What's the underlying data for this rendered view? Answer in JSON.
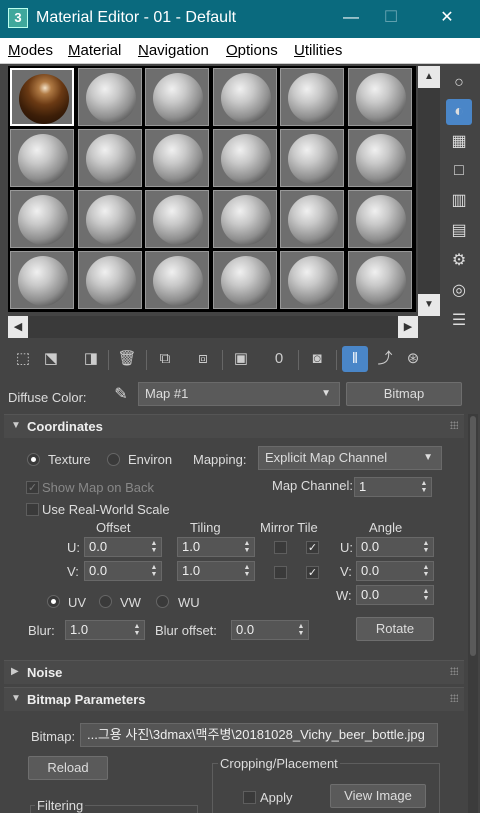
{
  "window": {
    "app_icon": "3",
    "title": "Material Editor - 01 - Default",
    "minimize": "—",
    "maximize": "☐",
    "close": "✕"
  },
  "menu": [
    {
      "label_u": "M",
      "label_rest": "odes"
    },
    {
      "label_u": "M",
      "label_rest": "aterial"
    },
    {
      "label_u": "N",
      "label_rest": "avigation"
    },
    {
      "label_u": "O",
      "label_rest": "ptions"
    },
    {
      "label_u": "U",
      "label_rest": "tilities"
    }
  ],
  "slots": {
    "rows": 4,
    "cols": 6,
    "active_slot": 0,
    "active_material": "beer-bottle-brown"
  },
  "map": {
    "diffuse_label": "Diffuse Color:",
    "map_name": "Map #1",
    "map_type_button": "Bitmap",
    "toolbar_value": "0"
  },
  "coordinates": {
    "title": "Coordinates",
    "texture_label": "Texture",
    "environ_label": "Environ",
    "mapping_label": "Mapping:",
    "mapping_value": "Explicit Map Channel",
    "show_map_on_back": "Show Map on Back",
    "map_channel_label": "Map Channel:",
    "map_channel_value": "1",
    "real_world": "Use Real-World Scale",
    "offset_header": "Offset",
    "tiling_header": "Tiling",
    "mirror_tile_header": "Mirror Tile",
    "angle_header": "Angle",
    "u_label": "U:",
    "v_label": "V:",
    "w_label": "W:",
    "offset_u": "0.0",
    "offset_v": "0.0",
    "tiling_u": "1.0",
    "tiling_v": "1.0",
    "tile_u_checked": "✓",
    "tile_v_checked": "✓",
    "angle_u": "0.0",
    "angle_v": "0.0",
    "angle_w": "0.0",
    "uv_label": "UV",
    "vw_label": "VW",
    "wu_label": "WU",
    "blur_label": "Blur:",
    "blur_value": "1.0",
    "blur_offset_label": "Blur offset:",
    "blur_offset_value": "0.0",
    "rotate_button": "Rotate"
  },
  "noise": {
    "title": "Noise"
  },
  "bitmap_params": {
    "title": "Bitmap Parameters",
    "bitmap_label": "Bitmap:",
    "bitmap_path": "...그용 사진\\3dmax\\맥주병\\20181028_Vichy_beer_bottle.jpg",
    "reload_button": "Reload",
    "cropping_label": "Cropping/Placement",
    "apply_label": "Apply",
    "view_image_button": "View Image",
    "filtering_label": "Filtering"
  }
}
